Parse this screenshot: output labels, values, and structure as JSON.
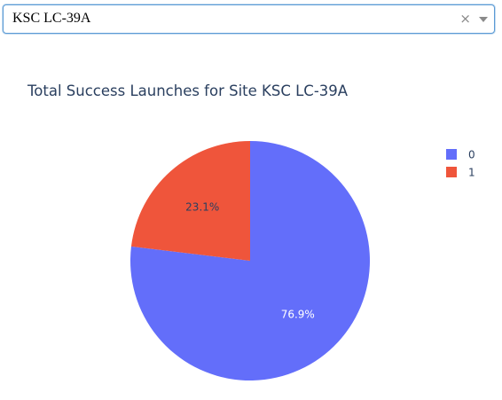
{
  "dropdown": {
    "value": "KSC LC-39A",
    "clear_glyph": "×",
    "clear_icon": "close-icon",
    "caret_icon": "chevron-down-icon"
  },
  "chart_data": {
    "type": "pie",
    "title": "Total Success Launches for Site KSC LC-39A",
    "slices": [
      {
        "label": "0",
        "percent": 76.9,
        "text": "76.9%",
        "color": "#636efa",
        "text_color": "#ffffff"
      },
      {
        "label": "1",
        "percent": 23.1,
        "text": "23.1%",
        "color": "#ef553b",
        "text_color": "#2a3f5f"
      }
    ],
    "legend": {
      "placement": "top-right",
      "entries": [
        "0",
        "1"
      ]
    }
  }
}
